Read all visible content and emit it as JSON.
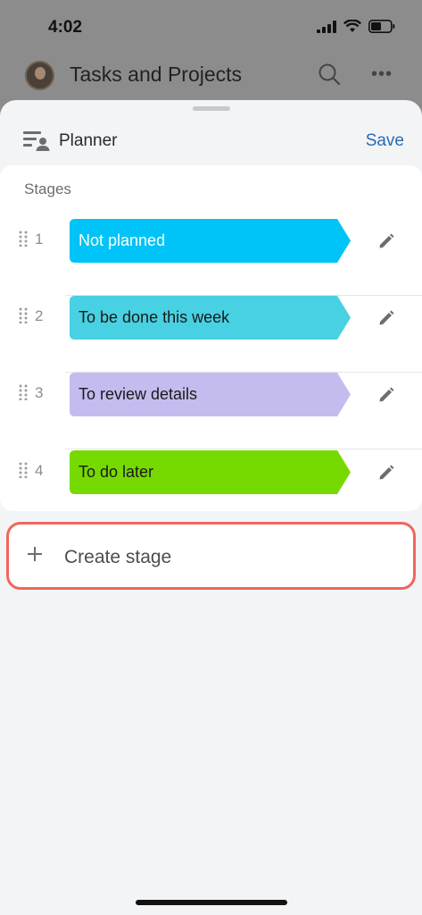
{
  "status_bar": {
    "time": "4:02"
  },
  "background_app": {
    "title": "Tasks and Projects"
  },
  "sheet": {
    "title": "Planner",
    "save_label": "Save",
    "stages_heading": "Stages",
    "stages": [
      {
        "number": "1",
        "name": "Not planned",
        "color": "#00c3f7",
        "text_color": "#ffffff"
      },
      {
        "number": "2",
        "name": "To be done this week",
        "color": "#47d1e2",
        "text_color": "#1a1a1a"
      },
      {
        "number": "3",
        "name": "To review details",
        "color": "#c4bcef",
        "text_color": "#1a1a1a"
      },
      {
        "number": "4",
        "name": "To do later",
        "color": "#76d900",
        "text_color": "#1a1a1a"
      }
    ],
    "create_label": "Create stage",
    "highlight_color": "#f0665c",
    "accent_color": "#2a69b5"
  },
  "icons": [
    "cellular-icon",
    "wifi-icon",
    "battery-icon",
    "search-icon",
    "more-icon",
    "planner-icon",
    "drag-handle-icon",
    "pencil-icon",
    "plus-icon"
  ]
}
